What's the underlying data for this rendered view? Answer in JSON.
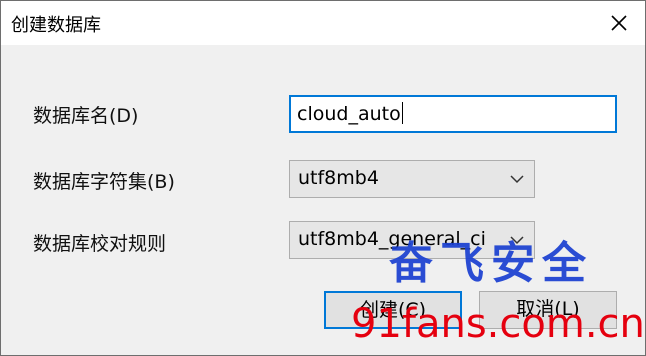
{
  "window": {
    "title": "创建数据库",
    "close_icon": "close-icon"
  },
  "form": {
    "name_label": "数据库名(D)",
    "name_value": "cloud_auto",
    "charset_label": "数据库字符集(B)",
    "charset_value": "utf8mb4",
    "collation_label": "数据库校对规则",
    "collation_value": "utf8mb4_general_ci"
  },
  "buttons": {
    "create": "创建(C)",
    "cancel": "取消(L)"
  },
  "watermark": {
    "chinese": "奋飞安全",
    "site": "91fans.com.cn",
    "chinese_color": "#1a3fd1",
    "site_color": "#e5000f"
  },
  "colors": {
    "accent": "#0078d7",
    "dialog_bg": "#f0f0f0"
  }
}
